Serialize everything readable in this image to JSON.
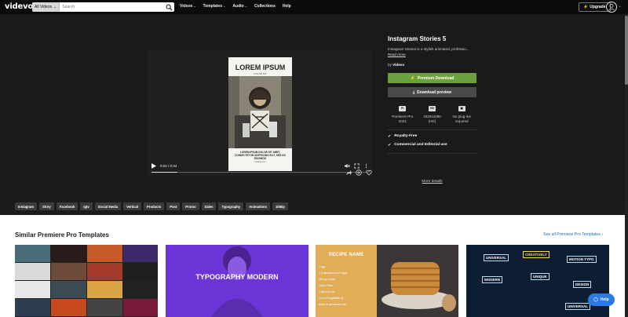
{
  "header": {
    "logo": "videvo",
    "search_scope": "All Videos",
    "search_placeholder": "Search",
    "nav": [
      {
        "label": "Videos",
        "caret": "⌄"
      },
      {
        "label": "Templates",
        "caret": "⌄"
      },
      {
        "label": "Audio",
        "caret": "⌄"
      },
      {
        "label": "Collections",
        "caret": ""
      },
      {
        "label": "Help",
        "caret": ""
      }
    ],
    "upgrade_label": "Upgrade"
  },
  "player": {
    "poster_title": "LOREM IPSUM",
    "poster_sub": "DOLOR SIT",
    "poster_caption": "LOREM IPSUM DOLOR SIT AMET, CONSECTETUR ADIPISCING ELIT, SED DO EIUSMOD",
    "poster_link": "• Swipe up •",
    "time": "0:04 / 0:34",
    "progress": 0.12
  },
  "details": {
    "title": "Instagram Stories 5",
    "description": "Instagram Stories is a stylish animated, professio...",
    "read_more": "Read more",
    "by_label": "by",
    "author": "Videvo",
    "premium_button": "Premium Download",
    "preview_button": "Download preview",
    "specs": [
      {
        "icon": "Pr",
        "line1": "Premiere Pro",
        "line2": "2021"
      },
      {
        "icon": "HD",
        "line1": "1920x1080",
        "line2": "(HD)"
      },
      {
        "icon": "▣",
        "line1": "No plug-ins",
        "line2": "required"
      }
    ],
    "features": [
      "Royalty-Free",
      "Commercial and Editorial use"
    ],
    "more_details": "More details"
  },
  "tags": [
    "Instagram",
    "Story",
    "Facebook",
    "Igtv",
    "Social Media",
    "Vertical",
    "Products",
    "Post",
    "Promo",
    "Sales",
    "Typography",
    "Animations",
    "1080p"
  ],
  "similar": {
    "title": "Similar Premiere Pro Templates",
    "see_all": "See all Premiere Pro Templates",
    "card2_title": "TYPOGRAPHY MODERN",
    "recipe_title": "RECIPE NAME",
    "recipe_lines": [
      "1 egg",
      "2-3 tablespoons of sugar",
      "3/4 cup of milk",
      "140g of flour",
      "1 pinch of salt",
      "1/2 cl of vegetable oil",
      "Butter to grease the pan"
    ],
    "card4_words": [
      "UNIVERSAL",
      "CREATIVELY",
      "MOTION TYPO",
      "MODERN",
      "UNIQUE",
      "DESIGN",
      "UNIVERSAL"
    ]
  },
  "help_label": "Help"
}
